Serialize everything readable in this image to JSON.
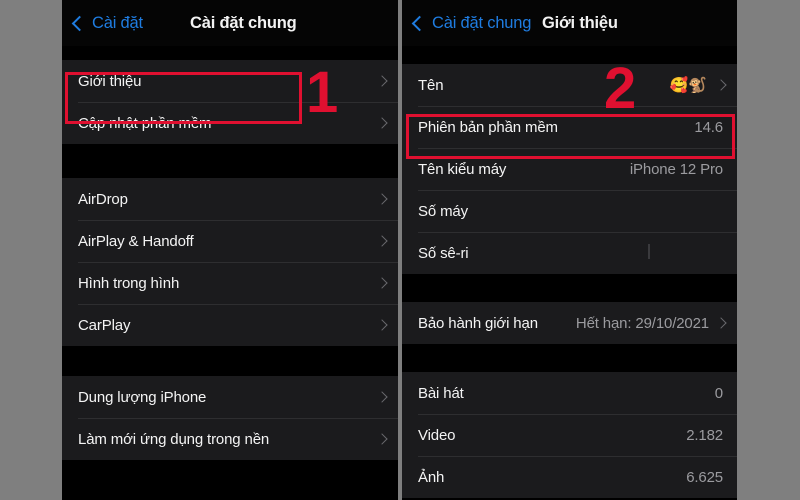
{
  "left_panel": {
    "navbar": {
      "back_label": "Cài đặt",
      "title": "Cài đặt chung"
    },
    "sections": [
      {
        "rows": [
          {
            "label": "Giới thiệu",
            "value": "",
            "chevron": true
          },
          {
            "label": "Cập nhật phần mềm",
            "value": "",
            "chevron": true
          }
        ]
      },
      {
        "rows": [
          {
            "label": "AirDrop",
            "value": "",
            "chevron": true
          },
          {
            "label": "AirPlay & Handoff",
            "value": "",
            "chevron": true
          },
          {
            "label": "Hình trong hình",
            "value": "",
            "chevron": true
          },
          {
            "label": "CarPlay",
            "value": "",
            "chevron": true
          }
        ]
      },
      {
        "rows": [
          {
            "label": "Dung lượng iPhone",
            "value": "",
            "chevron": true
          },
          {
            "label": "Làm mới ứng dụng trong nền",
            "value": "",
            "chevron": true
          }
        ]
      }
    ]
  },
  "right_panel": {
    "navbar": {
      "back_label": "Cài đặt chung",
      "title": "Giới thiệu"
    },
    "sections": [
      {
        "rows": [
          {
            "label": "Tên",
            "value": "",
            "emoji": "🥰🐒",
            "chevron": true
          },
          {
            "label": "Phiên bản phần mềm",
            "value": "14.6",
            "chevron": false
          },
          {
            "label": "Tên kiểu máy",
            "value": "iPhone 12 Pro",
            "chevron": false
          },
          {
            "label": "Số máy",
            "value": "",
            "chevron": false
          },
          {
            "label": "Số sê-ri",
            "value": "",
            "chevron": false
          }
        ]
      },
      {
        "rows": [
          {
            "label": "Bảo hành giới hạn",
            "value": "Hết hạn: 29/10/2021",
            "chevron": true
          }
        ]
      },
      {
        "rows": [
          {
            "label": "Bài hát",
            "value": "0",
            "chevron": false
          },
          {
            "label": "Video",
            "value": "2.182",
            "chevron": false
          },
          {
            "label": "Ảnh",
            "value": "6.625",
            "chevron": false
          }
        ]
      }
    ]
  },
  "annotations": {
    "step_one": "1",
    "step_two": "2",
    "highlight_color": "#e01030"
  }
}
